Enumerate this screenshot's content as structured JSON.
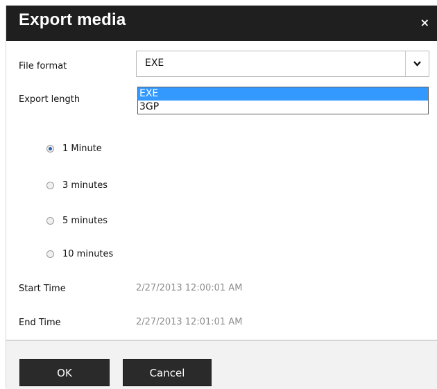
{
  "dialog": {
    "title": "Export media",
    "close_symbol": "×"
  },
  "form": {
    "file_format": {
      "label": "File format",
      "value": "EXE",
      "options": [
        "EXE",
        "3GP"
      ],
      "highlighted": "EXE"
    },
    "export_length": {
      "label": "Export length",
      "options": [
        {
          "label": "1 Minute",
          "selected": true
        },
        {
          "label": "3 minutes",
          "selected": false
        },
        {
          "label": "5 minutes",
          "selected": false
        },
        {
          "label": "10 minutes",
          "selected": false
        }
      ]
    },
    "start_time": {
      "label": "Start Time",
      "value": "2/27/2013 12:00:01 AM"
    },
    "end_time": {
      "label": "End Time",
      "value": "2/27/2013 12:01:01 AM"
    }
  },
  "footer": {
    "ok_label": "OK",
    "cancel_label": "Cancel"
  },
  "colors": {
    "titlebar": "#1f1f1f",
    "highlight": "#3399ff",
    "button": "#2a2a2a",
    "muted_text": "#8c8c8c"
  }
}
